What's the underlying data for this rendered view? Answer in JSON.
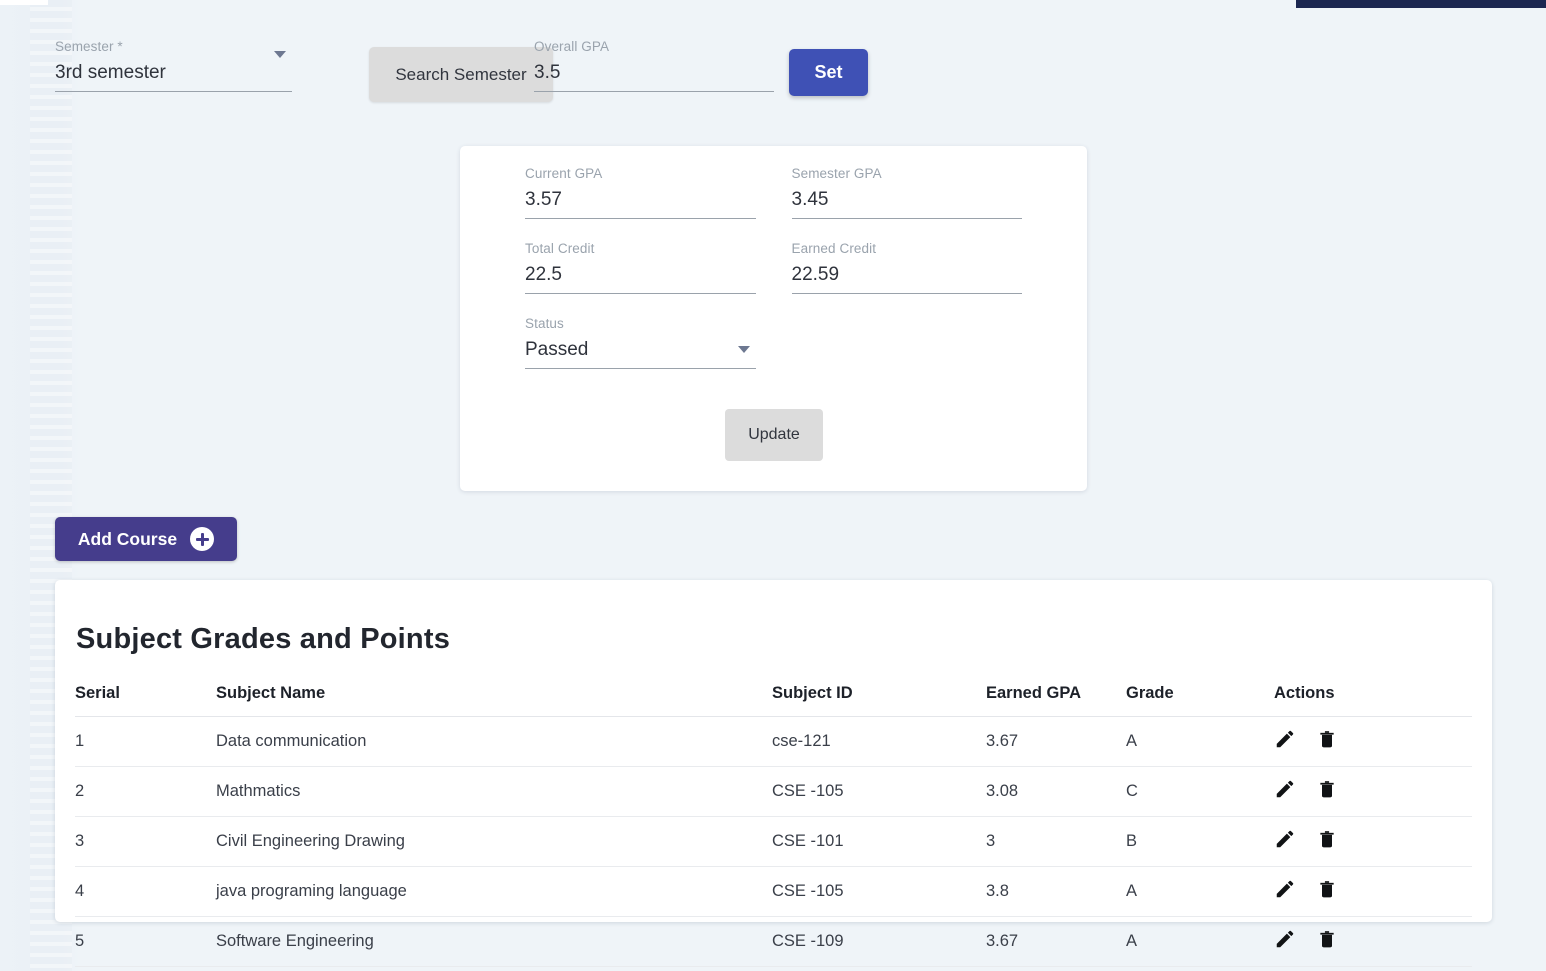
{
  "colors": {
    "page_background": "#eff4f8",
    "top_strip": "#1c2751",
    "set_button": "#3f51b5",
    "add_course_button": "#453d8c",
    "neutral_button": "#dcdcdc",
    "card_background": "#ffffff"
  },
  "toolbar": {
    "semester": {
      "label": "Semester *",
      "value": "3rd semester",
      "caret_icon": "chevron-down-icon"
    },
    "search_semester_label": "Search Semester",
    "overall_gpa": {
      "label": "Overall GPA",
      "value": "3.5"
    },
    "set_label": "Set"
  },
  "summary": {
    "current_gpa": {
      "label": "Current GPA",
      "value": "3.57"
    },
    "semester_gpa": {
      "label": "Semester GPA",
      "value": "3.45"
    },
    "total_credit": {
      "label": "Total Credit",
      "value": "22.5"
    },
    "earned_credit": {
      "label": "Earned Credit",
      "value": "22.59"
    },
    "status": {
      "label": "Status",
      "value": "Passed",
      "caret_icon": "chevron-down-icon"
    },
    "update_label": "Update"
  },
  "add_course": {
    "label": "Add Course",
    "icon": "plus-circle-icon"
  },
  "table": {
    "title": "Subject Grades and Points",
    "columns": [
      "Serial",
      "Subject Name",
      "Subject ID",
      "Earned GPA",
      "Grade",
      "Actions"
    ],
    "rows": [
      {
        "serial": "1",
        "subject_name": "Data communication",
        "subject_id": "cse-121",
        "earned_gpa": "3.67",
        "grade": "A"
      },
      {
        "serial": "2",
        "subject_name": "Mathmatics",
        "subject_id": "CSE -105",
        "earned_gpa": "3.08",
        "grade": "C"
      },
      {
        "serial": "3",
        "subject_name": "Civil Engineering Drawing",
        "subject_id": "CSE -101",
        "earned_gpa": "3",
        "grade": "B"
      },
      {
        "serial": "4",
        "subject_name": "java programing language",
        "subject_id": "CSE -105",
        "earned_gpa": "3.8",
        "grade": "A"
      },
      {
        "serial": "5",
        "subject_name": "Software Engineering",
        "subject_id": "CSE -109",
        "earned_gpa": "3.67",
        "grade": "A"
      }
    ],
    "row_actions": {
      "edit_icon": "pencil-icon",
      "delete_icon": "trash-icon"
    }
  }
}
